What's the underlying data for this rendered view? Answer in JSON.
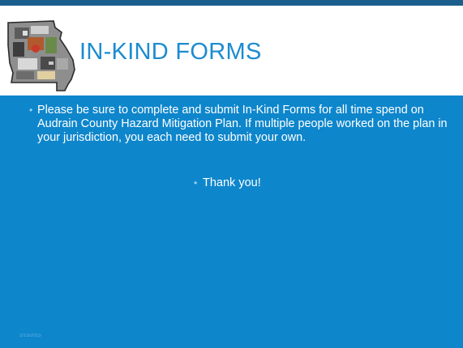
{
  "slide": {
    "title": "IN-KIND FORMS",
    "bullets": [
      "Please be sure to complete and submit In-Kind Forms for all time spend on Audrain County Hazard Mitigation Plan.  If multiple people worked on the plan in your jurisdiction, you each need to submit your own.",
      "Thank you!"
    ],
    "bullet_glyph": "•",
    "logo_icon": "missouri-map-collage-icon",
    "footer": "2/15/2015"
  },
  "colors": {
    "title": "#1b8bd0",
    "body_background": "#0e86cc",
    "top_rule": "#1a5f8c",
    "text": "#ffffff"
  }
}
